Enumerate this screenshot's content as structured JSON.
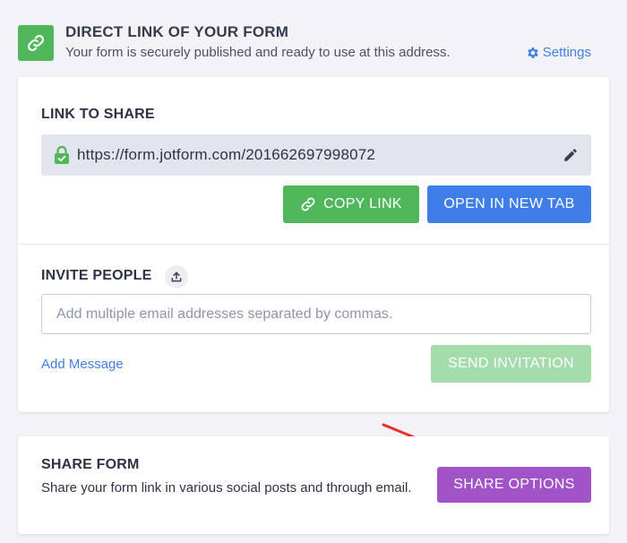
{
  "header": {
    "title": "DIRECT LINK OF YOUR FORM",
    "subtitle": "Your form is securely published and ready to use at this address.",
    "settings_label": "Settings"
  },
  "link_section": {
    "title": "LINK TO SHARE",
    "url": "https://form.jotform.com/201662697998072",
    "copy_label": "COPY LINK",
    "open_label": "OPEN IN NEW TAB"
  },
  "invite_section": {
    "title": "INVITE PEOPLE",
    "email_placeholder": "Add multiple email addresses separated by commas.",
    "email_value": "",
    "add_message_label": "Add Message",
    "send_label": "SEND INVITATION"
  },
  "share_section": {
    "title": "SHARE FORM",
    "description": "Share your form link in various social posts and through email.",
    "share_options_label": "SHARE OPTIONS"
  },
  "icons": {
    "header": "link-icon",
    "settings": "gear-icon",
    "lock": "lock-icon",
    "edit": "pencil-icon",
    "copy": "link-icon",
    "upload": "upload-icon"
  },
  "colors": {
    "green": "#4fb65a",
    "blue": "#3f7ee8",
    "light_green": "#a5dcab",
    "purple": "#a153c7",
    "annotation_arrow": "#e8302a"
  }
}
